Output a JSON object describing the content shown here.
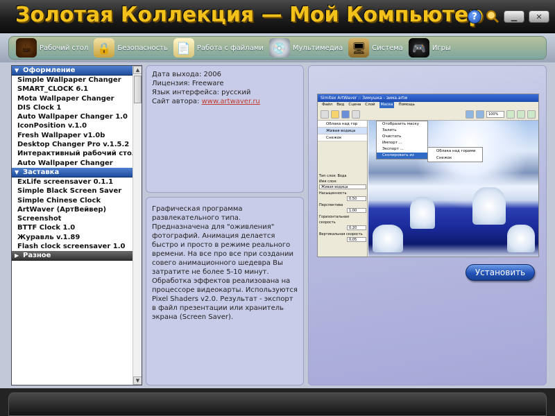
{
  "app": {
    "title": "Золотая Коллекция — Мой Компьютер",
    "help_label": "?",
    "minimize_label": "▁",
    "close_label": "✕"
  },
  "tabs": [
    {
      "label": "Рабочий стол",
      "icon": "coffee-cup-icon"
    },
    {
      "label": "Безопасность",
      "icon": "lock-icon"
    },
    {
      "label": "Работа с файлами",
      "icon": "documents-icon"
    },
    {
      "label": "Мультимедиа",
      "icon": "disc-icon"
    },
    {
      "label": "Система",
      "icon": "monitor-icon"
    },
    {
      "label": "Игры",
      "icon": "gamepad-icon"
    }
  ],
  "sidebar": {
    "groups": [
      {
        "title": "Оформление",
        "expanded": true,
        "items": [
          "Simple Wallpaper Changer",
          "SMART_CLOCK 6.1",
          "Mota Wallpaper Changer",
          "DIS Clock 1",
          "Auto Wallpaper Changer 1.0",
          "IconPosition v.1.0",
          "Fresh Wallpaper v1.0b",
          "Desktop Changer Pro v.1.5.2",
          "Интерактивный рабочий стол",
          "Auto Wallpaper Changer"
        ]
      },
      {
        "title": "Заставка",
        "expanded": true,
        "items": [
          "ExLife screensaver 0.1.1",
          "Simple Black Screen Saver",
          "Simple Chinese Clock",
          "ArtWaver (АртВейвер)",
          "Screenshot",
          "BTTF Clock 1.0",
          "Журавль v.1.89",
          "Flash clock screensaver 1.0"
        ]
      },
      {
        "title": "Разное",
        "expanded": false,
        "items": []
      }
    ]
  },
  "info": {
    "release": "Дата выхода: 2006",
    "license": "Лицензия: Freeware",
    "language": "Язык интерфейса: русский",
    "site_prefix": "Сайт автора: ",
    "site_link": "www.artwaver.ru"
  },
  "description": "Графическая программа развлекательного типа. Предназначена для \"оживления\" фотографий. Анимация делается быстро и просто в режиме реального времени. На все про все при создании совего анимационного шедевра Вы затратите не более 5-10 минут. Обработка эффектов реализована на процессоре видеокарты. Используются Pixel Shaders v2.0. Результат - экспорт в файл презентации или хранитель экрана (Screen Saver).",
  "preview": {
    "window_title": "Simitex ArtWaver :: Зимушка - зима.artw",
    "menu": [
      "Файл",
      "Вид",
      "Сцена",
      "Слой",
      "Маска",
      "Помощь"
    ],
    "zoom": "100%",
    "layers": [
      "Облака над гор",
      "Живая водица",
      "Снежок"
    ],
    "popup_items": [
      "Отобразить маску",
      "Залить",
      "Очистить",
      "Импорт ...",
      "Экспорт ...",
      "Скопировать из"
    ],
    "sub_items": [
      "Облака над горами",
      "Снежок"
    ],
    "props": [
      "Тип слоя: Вода",
      "Имя слоя:",
      "Живая водица",
      "Насыщенность",
      "0.50",
      "Перспектива",
      "1.00",
      "Горизонтальная скорость",
      "0.20",
      "Вертикальная скорость",
      "0.05"
    ]
  },
  "install_label": "Установить"
}
